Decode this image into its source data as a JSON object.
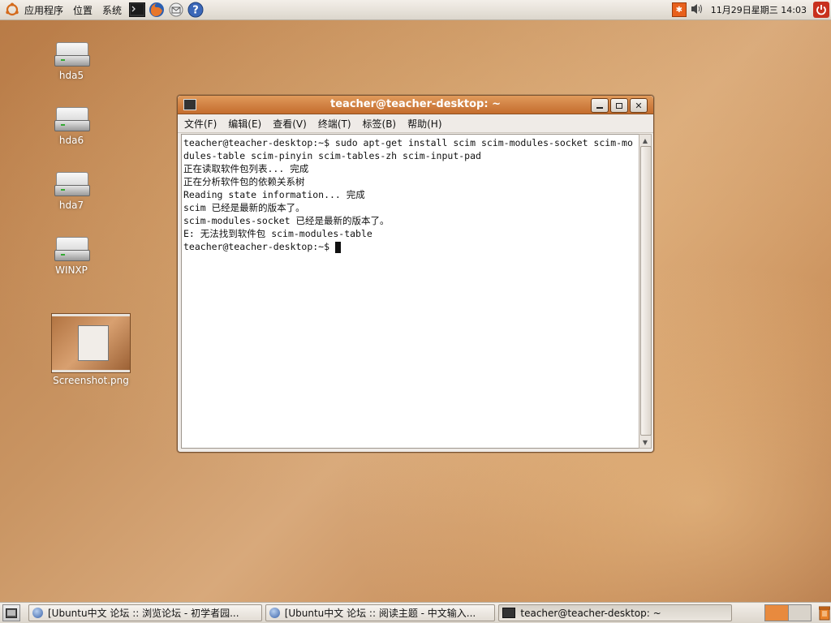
{
  "top_panel": {
    "menus": [
      "应用程序",
      "位置",
      "系统"
    ],
    "clock": "11月29日星期三 14:03"
  },
  "desktop": {
    "icons": [
      {
        "label": "hda5"
      },
      {
        "label": "hda6"
      },
      {
        "label": "hda7"
      },
      {
        "label": "WINXP"
      },
      {
        "label": "Screenshot.png"
      }
    ]
  },
  "terminal": {
    "title": "teacher@teacher-desktop: ~",
    "menus": [
      "文件(F)",
      "编辑(E)",
      "查看(V)",
      "终端(T)",
      "标签(B)",
      "帮助(H)"
    ],
    "lines": [
      "teacher@teacher-desktop:~$ sudo apt-get install scim scim-modules-socket scim-mo",
      "dules-table scim-pinyin scim-tables-zh scim-input-pad",
      "正在读取软件包列表... 完成",
      "正在分析软件包的依赖关系树",
      "Reading state information... 完成",
      "scim 已经是最新的版本了。",
      "scim-modules-socket 已经是最新的版本了。",
      "E: 无法找到软件包 scim-modules-table",
      "teacher@teacher-desktop:~$ "
    ]
  },
  "taskbar": {
    "tasks": [
      "[Ubuntu中文 论坛 :: 浏览论坛 - 初学者园...",
      "[Ubuntu中文 论坛 :: 阅读主题 - 中文输入...",
      "teacher@teacher-desktop: ~"
    ]
  },
  "colors": {
    "title_bar": "#d07e3e",
    "panel": "#e8e3dc"
  }
}
